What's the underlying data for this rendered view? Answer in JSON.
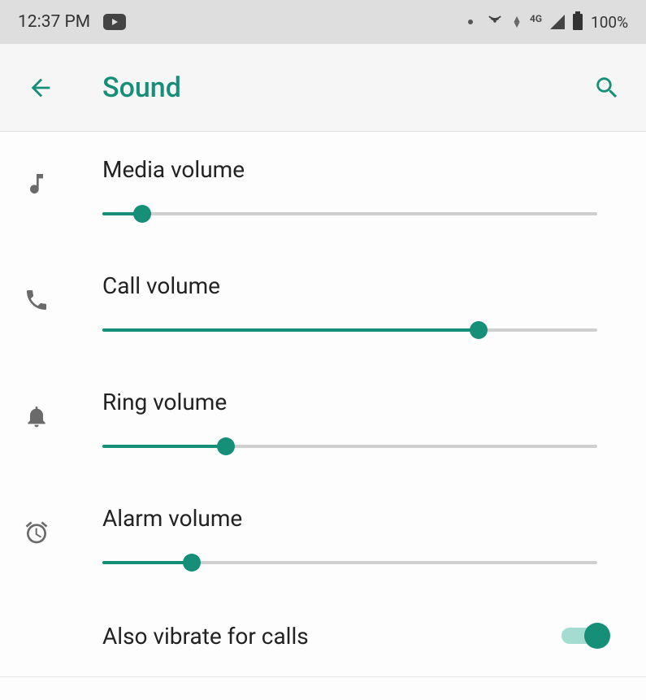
{
  "statusBar": {
    "time": "12:37 PM",
    "networkLabel": "4G",
    "batteryText": "100%"
  },
  "header": {
    "title": "Sound"
  },
  "colors": {
    "accent": "#158f77"
  },
  "volumes": [
    {
      "key": "media",
      "label": "Media volume",
      "value": 8
    },
    {
      "key": "call",
      "label": "Call volume",
      "value": 76
    },
    {
      "key": "ring",
      "label": "Ring volume",
      "value": 25
    },
    {
      "key": "alarm",
      "label": "Alarm volume",
      "value": 18
    }
  ],
  "vibrate": {
    "label": "Also vibrate for calls",
    "enabled": true
  }
}
